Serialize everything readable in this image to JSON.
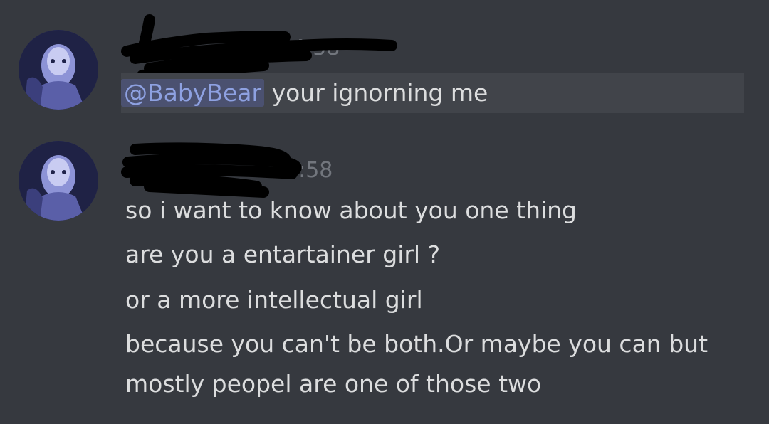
{
  "messages": [
    {
      "timestamp": "4:58",
      "mention": "@BabyBear",
      "text": " your ignorning me"
    },
    {
      "timestamp": "4:58",
      "lines": [
        "so i want to know about you one thing",
        "are you a entartainer girl ?",
        "or a more intellectual girl",
        "because you can't be both.Or maybe you can but",
        "mostly peopel are one of those two"
      ]
    }
  ]
}
